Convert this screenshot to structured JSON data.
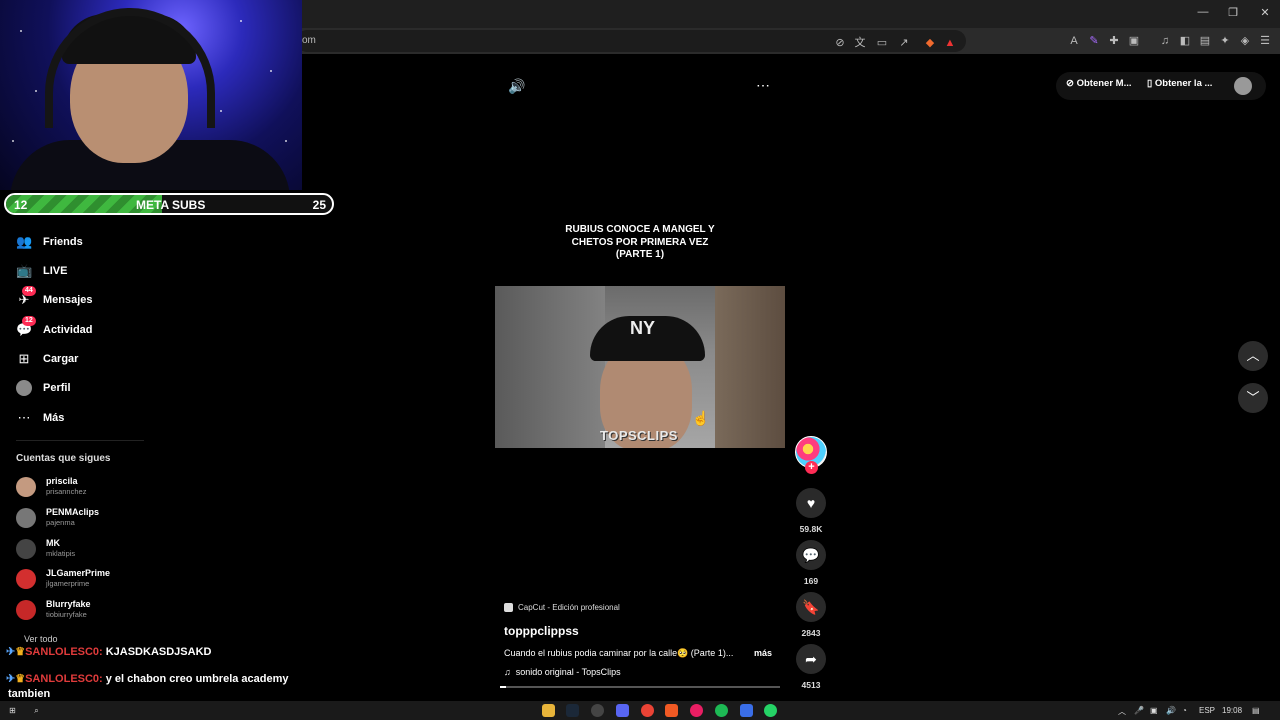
{
  "browser": {
    "url": "om",
    "window_controls": [
      "—",
      "❐",
      "✕"
    ]
  },
  "meta_subs": {
    "current": "12",
    "label": "META SUBS",
    "goal": "25",
    "progress": 0.48
  },
  "sidebar": {
    "items": [
      {
        "label": "Friends",
        "icon": "friends-icon",
        "badge": ""
      },
      {
        "label": "LIVE",
        "icon": "live-icon",
        "badge": ""
      },
      {
        "label": "Mensajes",
        "icon": "messages-icon",
        "badge": "44"
      },
      {
        "label": "Actividad",
        "icon": "activity-icon",
        "badge": "12"
      },
      {
        "label": "Cargar",
        "icon": "upload-icon",
        "badge": ""
      },
      {
        "label": "Perfil",
        "icon": "profile-icon",
        "badge": ""
      },
      {
        "label": "Más",
        "icon": "more-icon",
        "badge": ""
      }
    ],
    "following_title": "Cuentas que sigues",
    "accounts": [
      {
        "name": "priscila",
        "username": "prisannchez",
        "color": "#c49a80"
      },
      {
        "name": "PENMAclips",
        "username": "pajenma",
        "color": "#777777"
      },
      {
        "name": "MK",
        "username": "mklatipis",
        "color": "#444444"
      },
      {
        "name": "JLGamerPrime",
        "username": "jlgamerprime",
        "color": "#d32f2f"
      },
      {
        "name": "Blurryfake",
        "username": "tiobiurryfake",
        "color": "#c62828"
      }
    ],
    "see_all": "Ver todo"
  },
  "chat": [
    {
      "user": "SANLOLESC0:",
      "message": "KJASDKASDJSAKD"
    },
    {
      "user": "SANLOLESC0:",
      "message": "y el chabon creo umbrela academy"
    },
    {
      "user": "",
      "message": "tambien"
    }
  ],
  "header": {
    "get_coins": "Obtener M...",
    "get_app": "Obtener la ..."
  },
  "video": {
    "title": "RUBIUS CONOCE A MANGEL Y CHETOS POR PRIMERA VEZ (PARTE 1)",
    "watermark": "TOPSCLIPS",
    "cap_logo": "NY",
    "capcut": "CapCut - Edición profesional",
    "author": "topppclippss",
    "description": "Cuando el rubius podia caminar por la calle🥺 (Parte 1)...",
    "more": "más",
    "sound": "sonido original - TopsClips",
    "progress": 0.02
  },
  "actions": {
    "likes": "59.8K",
    "comments": "169",
    "saves": "2843",
    "shares": "4513"
  },
  "taskbar": {
    "lang": "ESP",
    "time": "19:08"
  }
}
